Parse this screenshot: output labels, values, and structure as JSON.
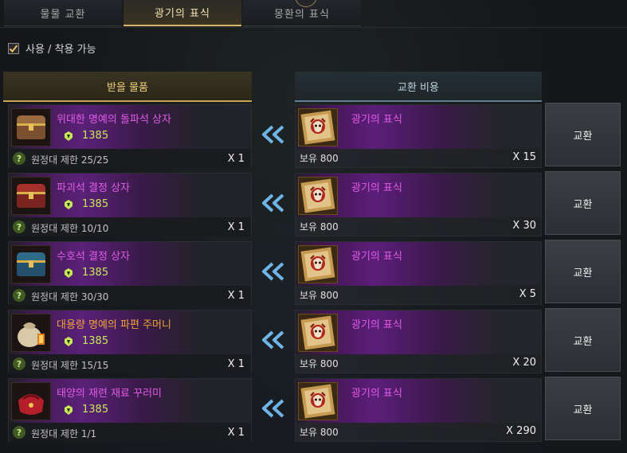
{
  "tabs": [
    "물물 교환",
    "광기의 표식",
    "몽환의 표식"
  ],
  "active_tab_index": 1,
  "filter": {
    "label": "사용 / 착용 가능",
    "checked": true
  },
  "headers": {
    "receive": "받을 물품",
    "cost": "교환 비용"
  },
  "colors": {
    "epic_name": "#e25be6",
    "legendary_name": "#f2a23a",
    "level": "#c8e85a",
    "active_tab": "#f4e3b5",
    "arrow": "#6fb4e6"
  },
  "rows": [
    {
      "item_name": "위대한 명예의 돌파석 상자",
      "item_grade_color": "#e25be6",
      "item_icon": "chest-icon",
      "level": "1385",
      "limit": "원정대 제한 25/25",
      "receive_qty": "X 1",
      "cost_name": "광기의 표식",
      "cost_icon": "madness-token-icon",
      "owned": "보유 800",
      "cost_qty": "X 15",
      "button": "교환"
    },
    {
      "item_name": "파괴석 결정 상자",
      "item_grade_color": "#e25be6",
      "item_icon": "red-chest-icon",
      "level": "1385",
      "limit": "원정대 제한 10/10",
      "receive_qty": "X 1",
      "cost_name": "광기의 표식",
      "cost_icon": "madness-token-icon",
      "owned": "보유 800",
      "cost_qty": "X 30",
      "button": "교환"
    },
    {
      "item_name": "수호석 결정 상자",
      "item_grade_color": "#e25be6",
      "item_icon": "blue-chest-icon",
      "level": "1385",
      "limit": "원정대 제한 30/30",
      "receive_qty": "X 1",
      "cost_name": "광기의 표식",
      "cost_icon": "madness-token-icon",
      "owned": "보유 800",
      "cost_qty": "X 5",
      "button": "교환"
    },
    {
      "item_name": "대용량 명예의 파편 주머니",
      "item_grade_color": "#f2a23a",
      "item_icon": "pouch-icon",
      "level": "1385",
      "limit": "원정대 제한 15/15",
      "receive_qty": "X 1",
      "cost_name": "광기의 표식",
      "cost_icon": "madness-token-icon",
      "owned": "보유 800",
      "cost_qty": "X 20",
      "button": "교환"
    },
    {
      "item_name": "태양의 재련 재료 꾸러미",
      "item_grade_color": "#e25be6",
      "item_icon": "red-bag-icon",
      "level": "1385",
      "limit": "원정대 제한 1/1",
      "receive_qty": "X 1",
      "cost_name": "광기의 표식",
      "cost_icon": "madness-token-icon",
      "owned": "보유 800",
      "cost_qty": "X 290",
      "button": "교환"
    }
  ]
}
